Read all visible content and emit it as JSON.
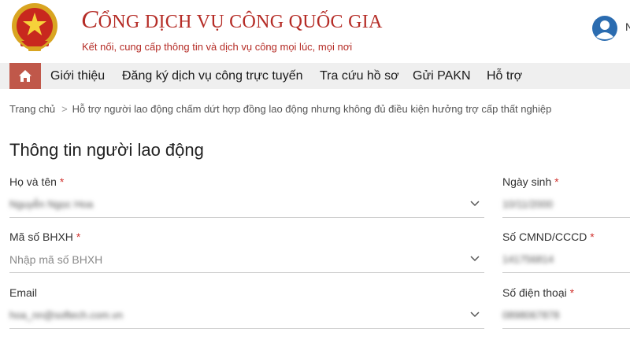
{
  "header": {
    "title_initial": "C",
    "title_rest": "ỔNG DỊCH VỤ CÔNG QUỐC GIA",
    "tagline": "Kết nối, cung cấp thông tin và dịch vụ công mọi lúc, mọi nơi",
    "user_name": "N"
  },
  "nav": {
    "items": [
      {
        "label": "Giới thiệu"
      },
      {
        "label": "Đăng ký dịch vụ công trực tuyến"
      },
      {
        "label": "Tra cứu hồ sơ"
      },
      {
        "label": "Gửi PAKN"
      },
      {
        "label": "Hỗ trợ"
      }
    ]
  },
  "breadcrumb": {
    "home": "Trang chủ",
    "separator": ">",
    "current": "Hỗ trợ người lao động chấm dứt hợp đồng lao động nhưng không đủ điều kiện hưởng trợ cấp thất nghiệp"
  },
  "form": {
    "title": "Thông tin người lao động",
    "fields": {
      "full_name": {
        "label": "Họ và tên",
        "value": "Nguyễn Ngọc Hoa",
        "required": "*"
      },
      "dob": {
        "label": "Ngày sinh",
        "value": "10/11/2000",
        "required": "*"
      },
      "bhxh": {
        "label": "Mã số BHXH",
        "placeholder": "Nhập mã số BHXH",
        "required": "*"
      },
      "id_number": {
        "label": "Số CMND/CCCD",
        "value": "141756814",
        "required": "*"
      },
      "email": {
        "label": "Email",
        "value": "hoa_nn@softech.com.vn"
      },
      "phone": {
        "label": "Số điện thoại",
        "value": "0898067878",
        "required": "*"
      }
    }
  },
  "colors": {
    "brand_red": "#b52c26",
    "home_button": "#c0584a",
    "nav_bg": "#efefef",
    "required": "#d0312d"
  }
}
